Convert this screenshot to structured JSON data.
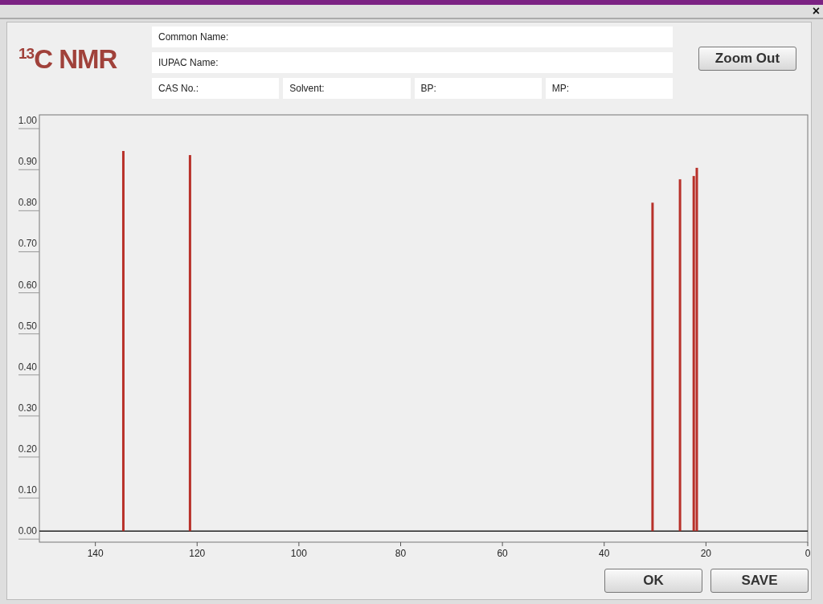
{
  "window": {
    "close": "×"
  },
  "title": "$^{13}$C NMR",
  "name_fields": [
    {
      "label": "Common Name:"
    },
    {
      "label": "IUPAC Name:"
    }
  ],
  "property_fields": [
    {
      "label": "CAS No.:"
    },
    {
      "label": "Solvent:"
    },
    {
      "label": "BP:"
    },
    {
      "label": "MP:"
    }
  ],
  "zoom_button": "Zoom Out",
  "chart_data": {
    "type": "bar",
    "xlim": [
      151,
      0
    ],
    "ylim": [
      -0.027,
      1.014
    ],
    "xticks": [
      140,
      120,
      100,
      80,
      60,
      40,
      20,
      0
    ],
    "yticks": [
      {
        "value": 0,
        "label": "0.00"
      },
      {
        "value": 0.1,
        "label": "0.10"
      },
      {
        "value": 0.2,
        "label": "0.20"
      },
      {
        "value": 0.3,
        "label": "0.30"
      },
      {
        "value": 0.4,
        "label": "0.40"
      },
      {
        "value": 0.5,
        "label": "0.50"
      },
      {
        "value": 0.6,
        "label": "0.60"
      },
      {
        "value": 0.7,
        "label": "0.70"
      },
      {
        "value": 0.8,
        "label": "0.80"
      },
      {
        "value": 0.9,
        "label": "0.90"
      },
      {
        "value": 1,
        "label": "1.00"
      }
    ],
    "x": [
      134.5,
      121.4,
      30.5,
      25.1,
      22.4,
      21.8
    ],
    "series": [
      {
        "color": "#b8312a",
        "values": [
          0.926,
          0.916,
          0.8,
          0.857,
          0.865,
          0.885
        ]
      }
    ]
  },
  "buttons": [
    "OK",
    "SAVE"
  ]
}
